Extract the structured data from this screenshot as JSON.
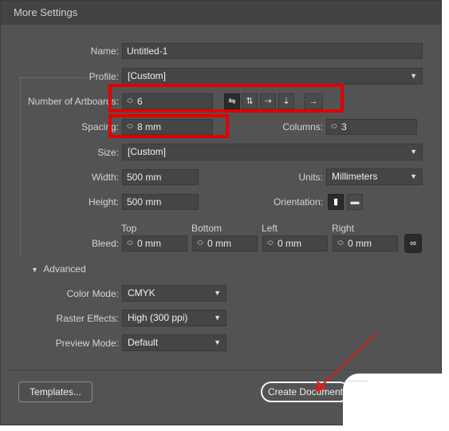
{
  "window": {
    "title": "More Settings"
  },
  "name": {
    "label": "Name:",
    "value": "Untitled-1"
  },
  "profile": {
    "label": "Profile:",
    "value": "[Custom]"
  },
  "artboards": {
    "label": "Number of Artboards:",
    "value": "6",
    "layout_icons": [
      "grid-by-row-icon",
      "grid-by-column-icon",
      "arrange-by-row-icon",
      "arrange-by-column-icon",
      "right-to-left-icon"
    ]
  },
  "spacing": {
    "label": "Spacing:",
    "value": "8 mm"
  },
  "columns": {
    "label": "Columns:",
    "value": "3"
  },
  "size": {
    "label": "Size:",
    "value": "[Custom]"
  },
  "width": {
    "label": "Width:",
    "value": "500 mm"
  },
  "units": {
    "label": "Units:",
    "value": "Millimeters"
  },
  "height": {
    "label": "Height:",
    "value": "500 mm"
  },
  "orientation": {
    "label": "Orientation:"
  },
  "bleed": {
    "label": "Bleed:",
    "top": {
      "label": "Top",
      "value": "0 mm"
    },
    "bottom": {
      "label": "Bottom",
      "value": "0 mm"
    },
    "left": {
      "label": "Left",
      "value": "0 mm"
    },
    "right": {
      "label": "Right",
      "value": "0 mm"
    }
  },
  "advanced": {
    "label": "Advanced",
    "color_mode": {
      "label": "Color Mode:",
      "value": "CMYK"
    },
    "raster_effects": {
      "label": "Raster Effects:",
      "value": "High (300 ppi)"
    },
    "preview_mode": {
      "label": "Preview Mode:",
      "value": "Default"
    }
  },
  "buttons": {
    "templates": "Templates...",
    "create": "Create Document"
  },
  "annotation": {
    "highlight_color": "#e00000",
    "arrow_color": "#d42020"
  }
}
